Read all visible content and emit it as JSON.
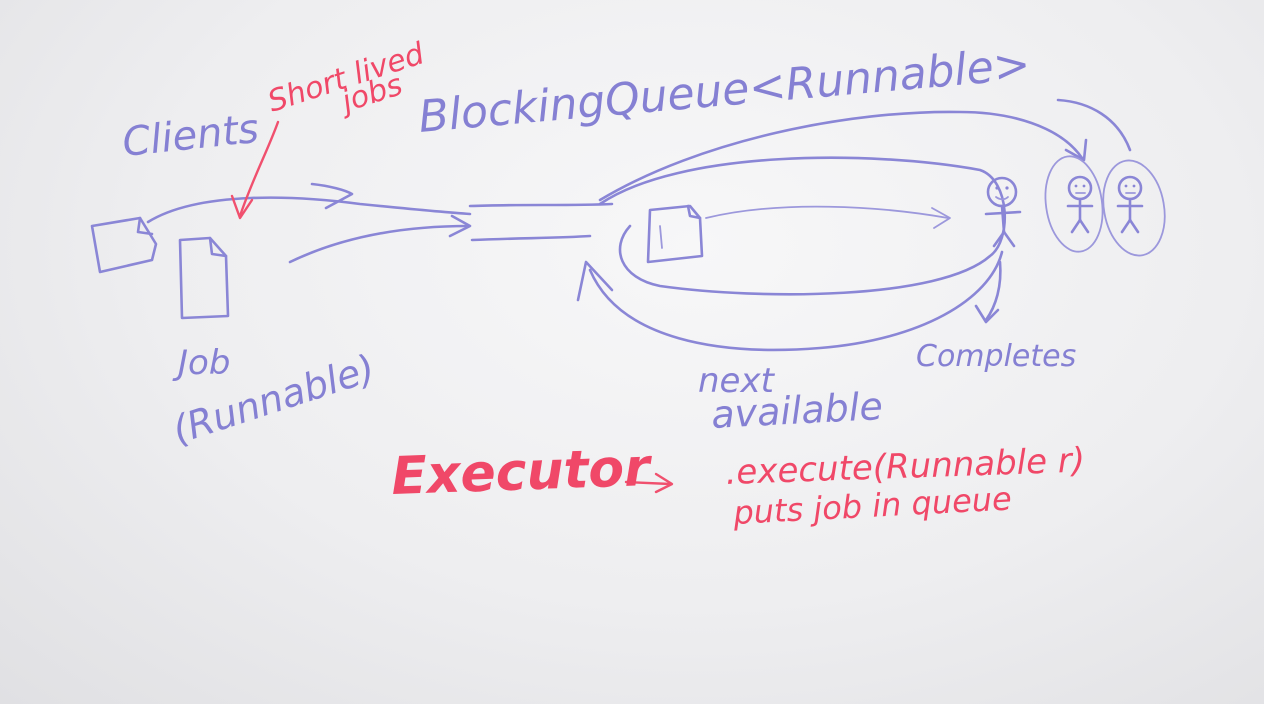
{
  "labels": {
    "clients": "Clients",
    "short_lived_line1": "Short lived",
    "short_lived_line2": "jobs",
    "blocking_queue": "BlockingQueue<Runnable>",
    "job_line1": "Job",
    "job_line2": "(Runnable)",
    "next_line1": "next",
    "next_line2": "available",
    "completes": "Completes",
    "executor": "Executor",
    "arrow": "->",
    "execute_call": ".execute(Runnable r)",
    "puts_job": "puts job in queue"
  },
  "colors": {
    "blue_marker": "#8a86d6",
    "red_marker": "#f0506e",
    "board": "#efeff1"
  },
  "icons": {
    "worker": "stick-figure-icon",
    "job": "document-icon"
  }
}
